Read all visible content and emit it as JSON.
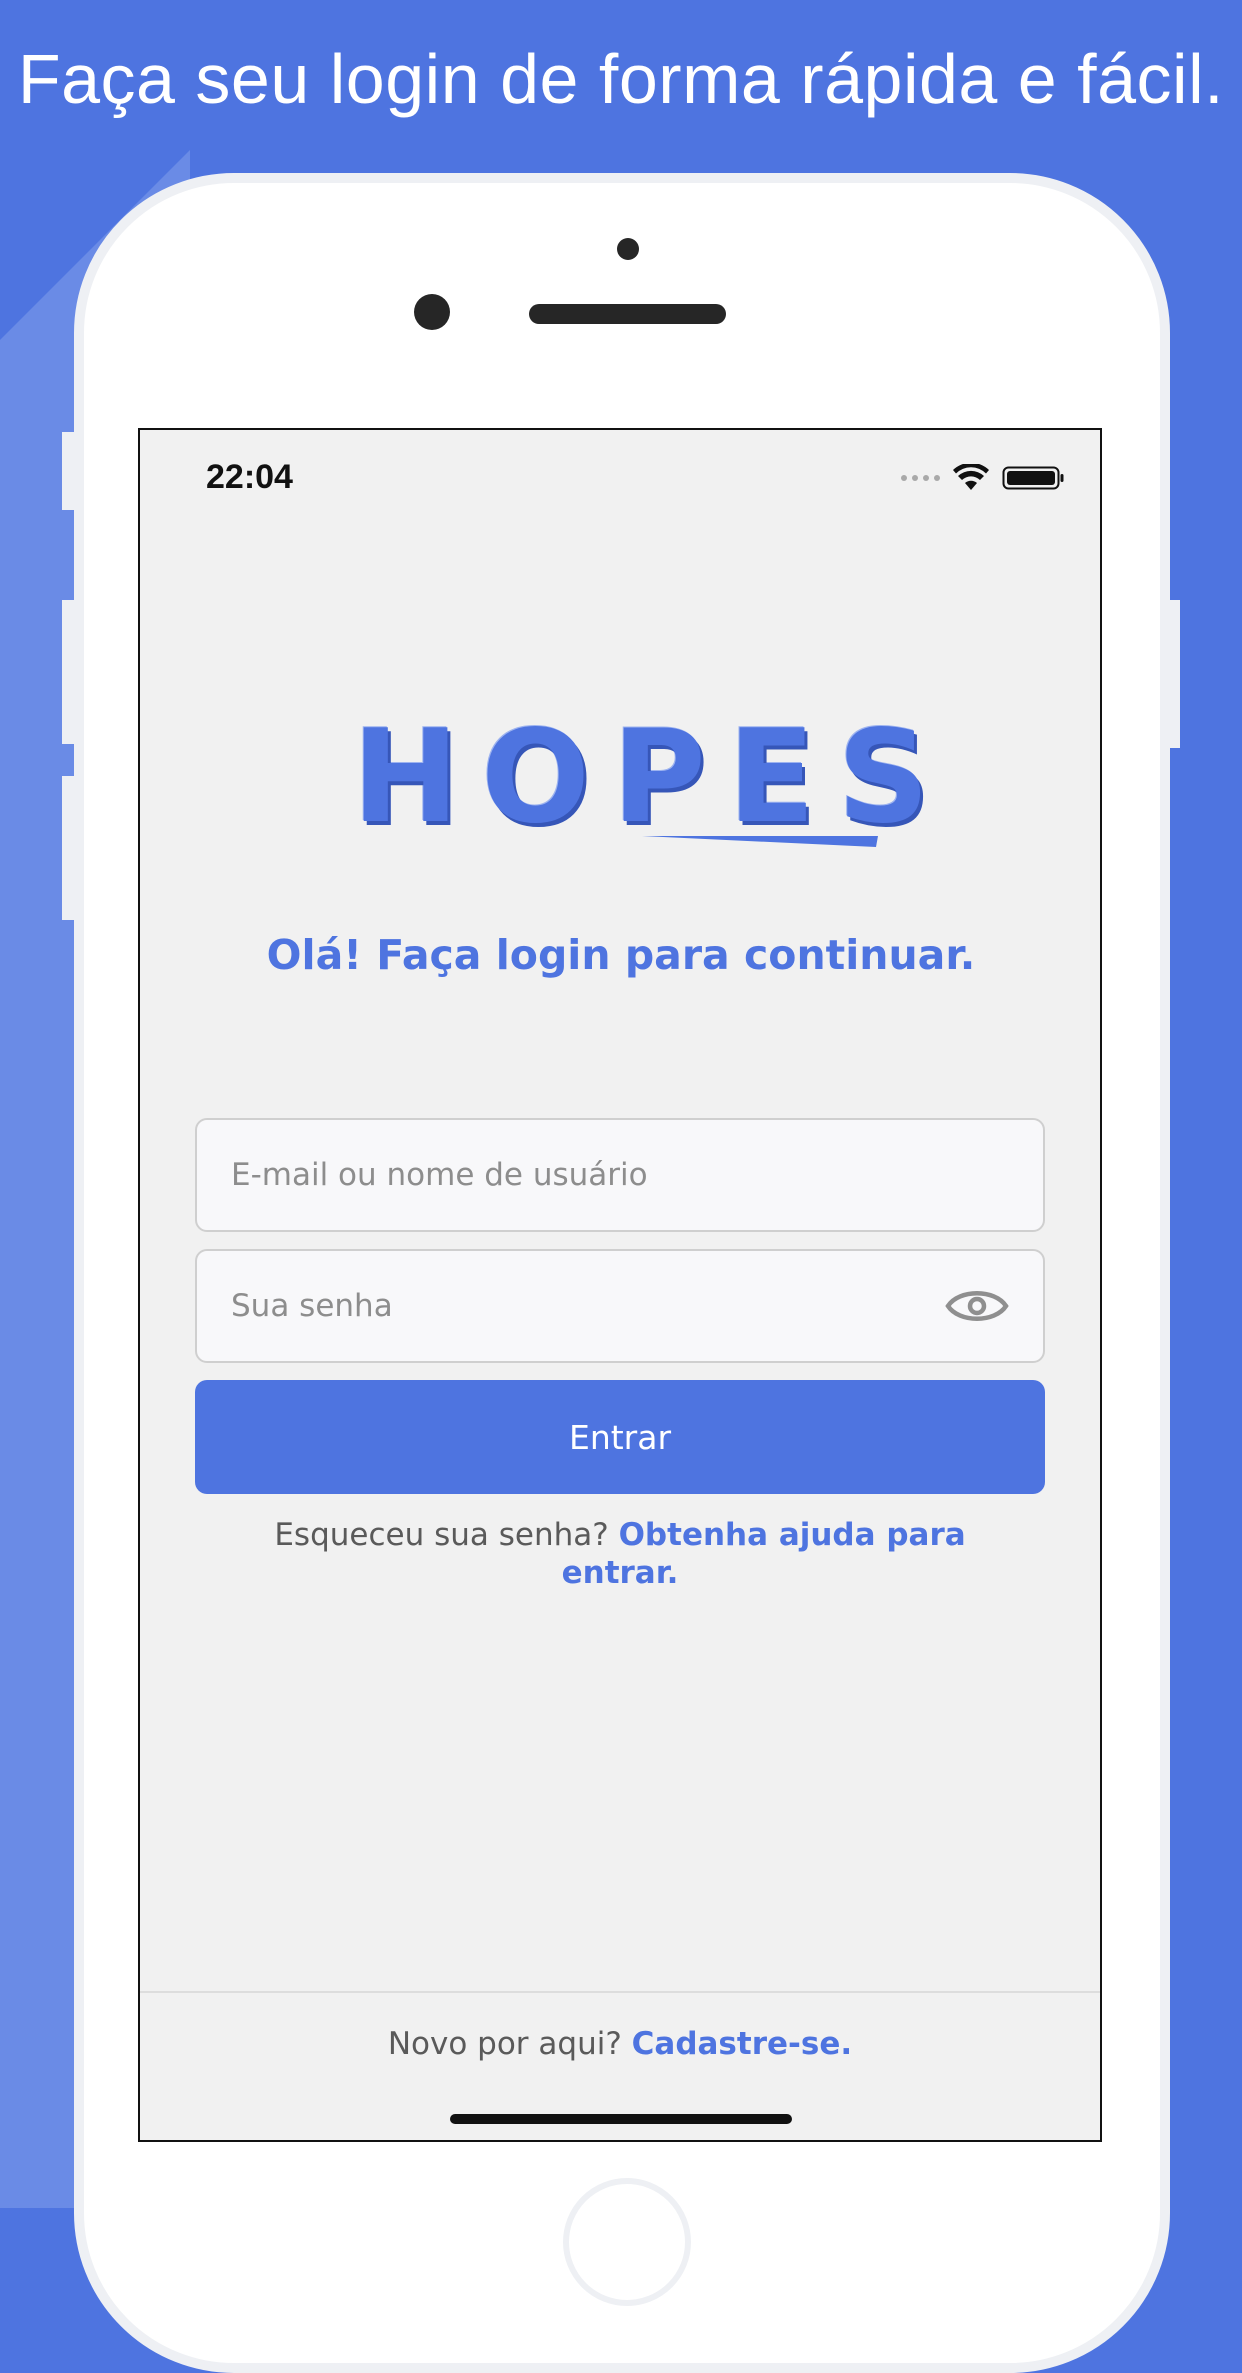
{
  "banner": {
    "headline": "Faça seu login de forma rápida e fácil."
  },
  "status_bar": {
    "time": "22:04",
    "icons": [
      "signal-dots-icon",
      "wifi-icon",
      "battery-icon"
    ]
  },
  "app": {
    "logo_text": "HOPES",
    "greeting": "Olá! Faça login para continuar.",
    "email_placeholder": "E-mail ou nome de usuário",
    "password_placeholder": "Sua senha",
    "login_button": "Entrar",
    "forgot_prefix": "Esqueceu sua senha?",
    "forgot_link": "Obtenha ajuda para entrar.",
    "signup_prefix": "Novo por aqui?",
    "signup_link": "Cadastre-se."
  },
  "colors": {
    "background": "#4e74e0",
    "accent": "#4e74e0",
    "screen_background": "#f1f1f1",
    "text_muted": "#5a5a5a"
  }
}
